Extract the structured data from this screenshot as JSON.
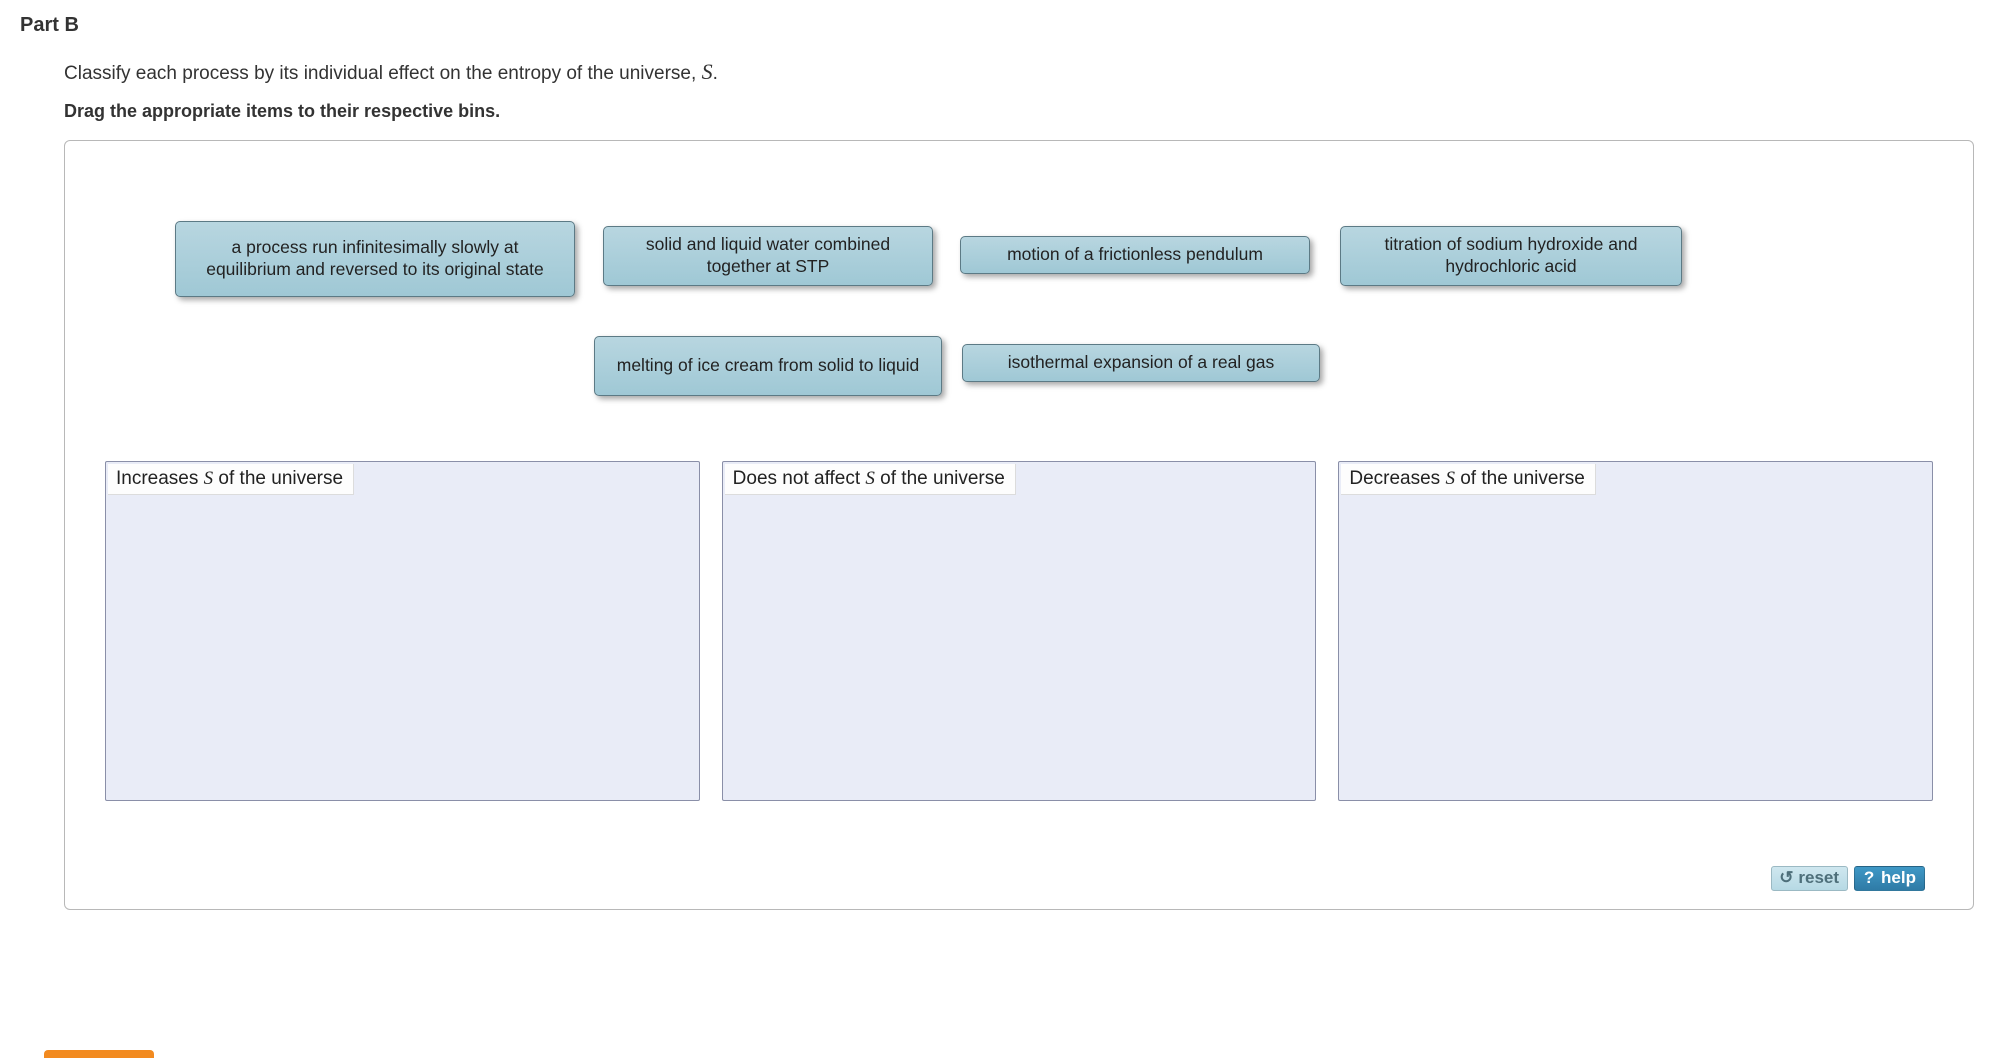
{
  "part_title": "Part B",
  "prompt_pre": "Classify each process by its individual effect on the entropy of the universe, ",
  "prompt_var": "S",
  "prompt_post": ".",
  "drag_instruction": "Drag the appropriate items to their respective bins.",
  "chips": {
    "c1": "a process run infinitesimally slowly at equilibrium and reversed to its original state",
    "c2": "solid and liquid water combined together at STP",
    "c3": "motion of a frictionless pendulum",
    "c4": "titration of sodium hydroxide and hydrochloric acid",
    "c5": "melting of ice cream from solid to liquid",
    "c6": "isothermal expansion of a real gas"
  },
  "bins": {
    "b1_pre": "Increases ",
    "b1_var": "S",
    "b1_post": " of the universe",
    "b2_pre": "Does not affect ",
    "b2_var": "S",
    "b2_post": " of the universe",
    "b3_pre": "Decreases ",
    "b3_var": "S",
    "b3_post": " of the universe"
  },
  "buttons": {
    "reset": "reset",
    "help": "help"
  },
  "icons": {
    "reset": "↺",
    "help": "?"
  }
}
